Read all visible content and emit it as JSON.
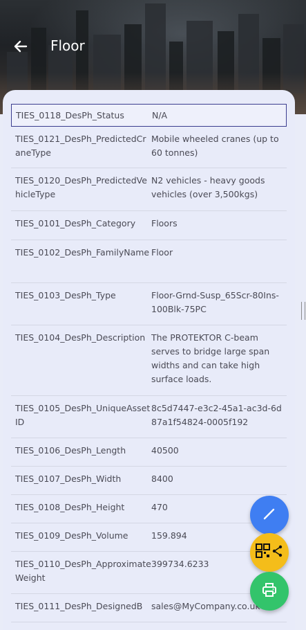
{
  "header": {
    "title": "Floor"
  },
  "rows": [
    {
      "key": "TIES_0118_DesPh_Status",
      "value": "N/A"
    },
    {
      "key": "TIES_0121_DesPh_PredictedCraneType",
      "value": "Mobile wheeled cranes (up to 60 tonnes)"
    },
    {
      "key": "TIES_0120_DesPh_PredictedVehicleType",
      "value": "N2 vehicles - heavy goods vehicles (over 3,500kgs)"
    },
    {
      "key": "TIES_0101_DesPh_Category",
      "value": "Floors"
    },
    {
      "key": "TIES_0102_DesPh_FamilyName",
      "value": "Floor"
    },
    {
      "key": "TIES_0103_DesPh_Type",
      "value": "Floor-Grnd-Susp_65Scr-80Ins-100Blk-75PC"
    },
    {
      "key": "TIES_0104_DesPh_Description",
      "value": "The PROTEKTOR C-beam serves to bridge large span widths and can take high surface loads."
    },
    {
      "key": "TIES_0105_DesPh_UniqueAssetID",
      "value": "8c5d7447-e3c2-45a1-ac3d-6d87a1f54824-0005f192"
    },
    {
      "key": "TIES_0106_DesPh_Length",
      "value": "40500"
    },
    {
      "key": "TIES_0107_DesPh_Width",
      "value": "8400"
    },
    {
      "key": "TIES_0108_DesPh_Height",
      "value": "470"
    },
    {
      "key": "TIES_0109_DesPh_Volume",
      "value": "159.894"
    },
    {
      "key": "TIES_0110_DesPh_ApproximateWeight",
      "value": "399734.6233"
    },
    {
      "key": "TIES_0111_DesPh_DesignedB",
      "value": "sales@MyCompany.co.uk"
    }
  ],
  "icons": {
    "back": "arrow-left-icon",
    "edit": "pencil-icon",
    "share": "qr-share-icon",
    "print": "printer-icon"
  },
  "colors": {
    "edit_fab": "#3f7ef2",
    "share_fab": "#f4bd1a",
    "print_fab": "#33c46b",
    "card_bg": "#e8ebf9"
  }
}
